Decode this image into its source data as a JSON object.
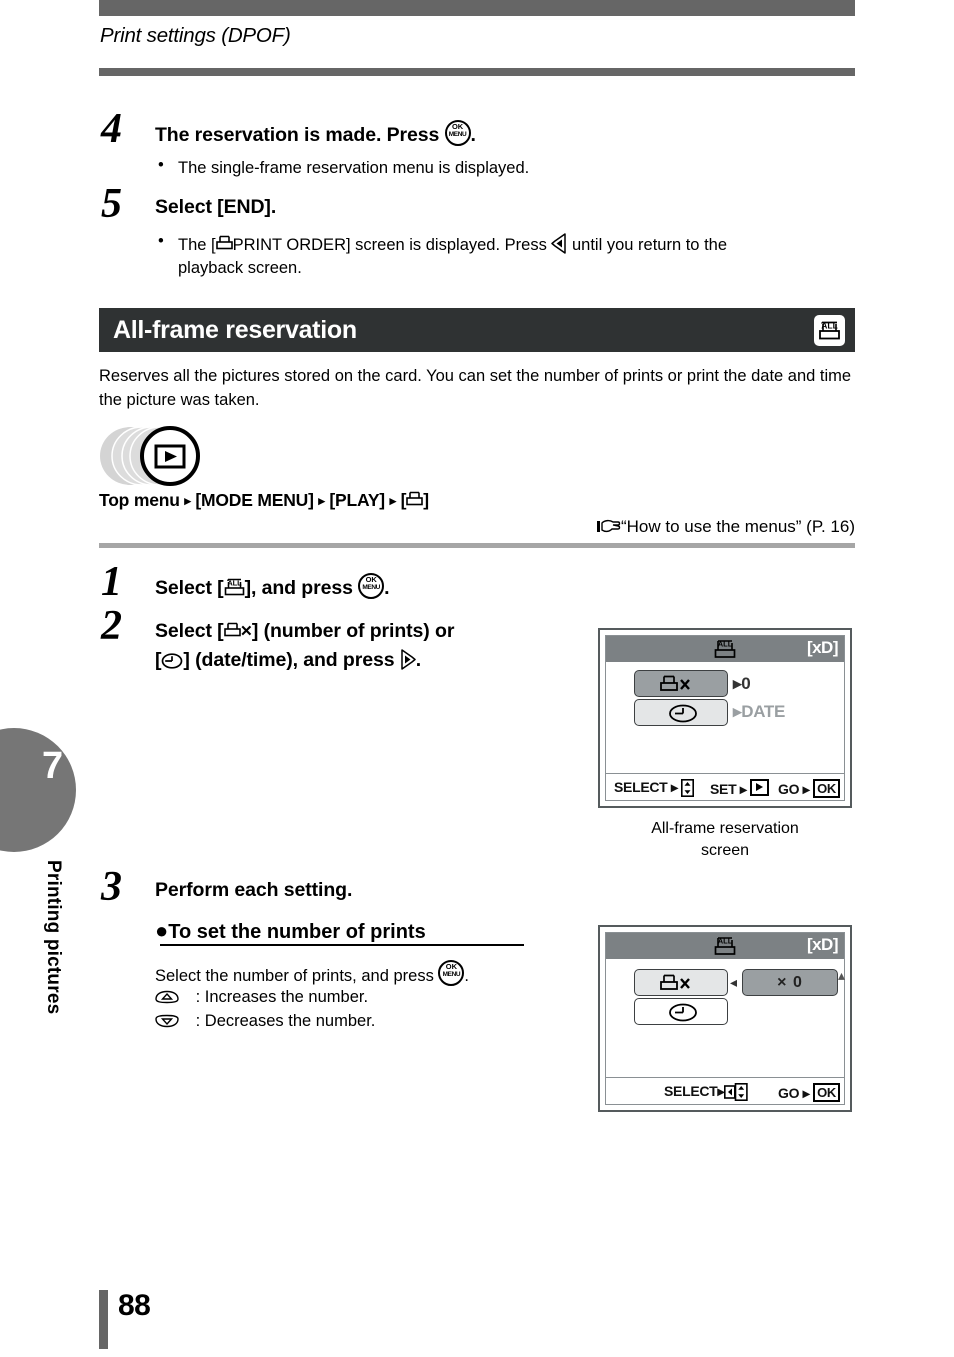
{
  "header": {
    "title": "Print settings (DPOF)"
  },
  "steps_top": [
    {
      "num": "4",
      "heading_pre": "The reservation is made. Press ",
      "heading_post": ".",
      "icon": "ok-menu-button-icon",
      "bullets": [
        "The single-frame reservation menu is displayed."
      ]
    },
    {
      "num": "5",
      "heading_pre": "Select [END].",
      "heading_post": "",
      "bullets_rich": {
        "part1": "The [",
        "icon1": "printer-icon",
        "part2": "PRINT ORDER] screen is displayed. Press ",
        "icon2": "left-arrow-pad-icon",
        "part3": " until you return to the",
        "line2": "playback screen."
      }
    }
  ],
  "section": {
    "title": "All-frame reservation",
    "icon": "printer-all-icon",
    "description": "Reserves all the pictures stored on the card. You can set the number of prints or print the date and time the picture was taken."
  },
  "mode_icon": "playback-mode-dial-icon",
  "menu_path": {
    "text_top": "Top menu",
    "sep": "▸",
    "item1": "[MODE MENU]",
    "item2": "[PLAY]",
    "item3_open": "[",
    "item3_icon": "printer-icon",
    "item3_close": "]",
    "reference_icon": "pointing-hand-icon",
    "reference": "“How to use the menus” (P. 16)"
  },
  "steps_main": [
    {
      "num": "1",
      "pre": "Select [",
      "icon": "printer-all-icon",
      "mid": "], and press ",
      "icon2": "ok-menu-button-icon",
      "post": "."
    },
    {
      "num": "2",
      "line1_pre": "Select [",
      "line1_icon": "printer-icon",
      "line1_x": "×",
      "line1_post": "] (number of prints) or",
      "line2_pre": "[",
      "line2_icon": "clock-date-icon",
      "line2_post": "] (date/time), and press ",
      "line2_icon2": "right-arrow-pad-icon",
      "line2_end": "."
    },
    {
      "num": "3",
      "heading": "Perform each setting.",
      "subhead_bullet": "●",
      "subhead": "To set the number of prints",
      "body_pre": "Select the number of prints, and press ",
      "body_icon": "ok-menu-button-icon",
      "body_post": ".",
      "rows": [
        {
          "icon": "up-arrow-pad-icon",
          "sep": ":",
          "text": "Increases the number."
        },
        {
          "icon": "down-arrow-pad-icon",
          "sep": ":",
          "text": "Decreases the number."
        }
      ]
    }
  ],
  "lcd1": {
    "card_label": "[xD]",
    "top_icon": "printer-all-icon",
    "rows": [
      {
        "icon": "printer-x-icon",
        "selected": true,
        "value": "0",
        "value_dim": false,
        "arrow": "▸"
      },
      {
        "icon": "clock-date-icon",
        "selected": false,
        "value": "DATE",
        "value_dim": true,
        "arrow": "▸"
      }
    ],
    "hints": [
      {
        "label": "SELECT",
        "arrow": "▸",
        "key": "updown-pad-icon"
      },
      {
        "label": "SET",
        "arrow": "▸",
        "key": "play-button-icon"
      },
      {
        "label": "GO",
        "arrow": "▸",
        "key": "OK"
      }
    ],
    "caption_line1": "All-frame reservation",
    "caption_line2": "screen"
  },
  "lcd2": {
    "card_label": "[xD]",
    "top_icon": "printer-all-icon",
    "rows": [
      {
        "icon": "printer-x-icon",
        "selected": false
      },
      {
        "icon": "clock-date-icon",
        "selected": false
      }
    ],
    "value_box": "× 0",
    "left_caret": "◂",
    "up_caret": "▴",
    "hints": [
      {
        "label": "SELECT",
        "arrow": "▸",
        "key": "leftupdown-pad-icon"
      },
      {
        "label": "GO",
        "arrow": "▸",
        "key": "OK"
      }
    ]
  },
  "sidebar": {
    "chapter_number": "7",
    "chapter_label": "Printing pictures"
  },
  "footer": {
    "page_number": "88"
  }
}
